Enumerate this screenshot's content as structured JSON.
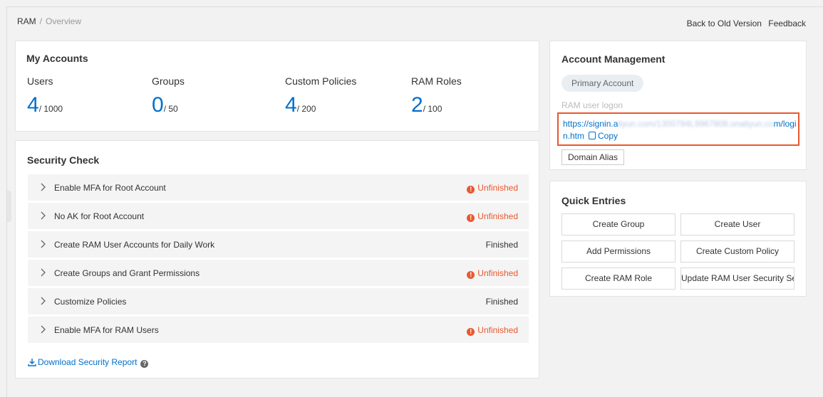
{
  "breadcrumb": {
    "root": "RAM",
    "separator": "/",
    "current": "Overview"
  },
  "top_links": {
    "back": "Back to Old Version",
    "feedback": "Feedback"
  },
  "my_accounts": {
    "title": "My Accounts",
    "stats": [
      {
        "label": "Users",
        "value": "4",
        "quota": "/ 1000"
      },
      {
        "label": "Groups",
        "value": "0",
        "quota": "/ 50"
      },
      {
        "label": "Custom Policies",
        "value": "4",
        "quota": "/ 200"
      },
      {
        "label": "RAM Roles",
        "value": "2",
        "quota": "/ 100"
      }
    ]
  },
  "security_check": {
    "title": "Security Check",
    "items": [
      {
        "name": "Enable MFA for Root Account",
        "status": "Unfinished",
        "state": "unfinished"
      },
      {
        "name": "No AK for Root Account",
        "status": "Unfinished",
        "state": "unfinished"
      },
      {
        "name": "Create RAM User Accounts for Daily Work",
        "status": "Finished",
        "state": "finished"
      },
      {
        "name": "Create Groups and Grant Permissions",
        "status": "Unfinished",
        "state": "unfinished"
      },
      {
        "name": "Customize Policies",
        "status": "Finished",
        "state": "finished"
      },
      {
        "name": "Enable MFA for RAM Users",
        "status": "Unfinished",
        "state": "unfinished"
      }
    ],
    "download_label": "Download Security Report"
  },
  "account_management": {
    "title": "Account Management",
    "primary_label": "Primary Account",
    "logon_label": "RAM user logon",
    "url_start": "https://signin.a",
    "url_blurred": "liyun.com/1300794L9967808.onaliyun.co",
    "url_end_line1": "m/logi",
    "url_line2": "n.htm",
    "copy_label": "Copy",
    "alias_label": "Domain Alias"
  },
  "quick_entries": {
    "title": "Quick Entries",
    "buttons": [
      "Create Group",
      "Create User",
      "Add Permissions",
      "Create Custom Policy",
      "Create RAM Role",
      "Update RAM User Security Se"
    ]
  },
  "colors": {
    "link": "#0070cc",
    "warning": "#e8582f",
    "highlight_border": "#e8582f"
  }
}
